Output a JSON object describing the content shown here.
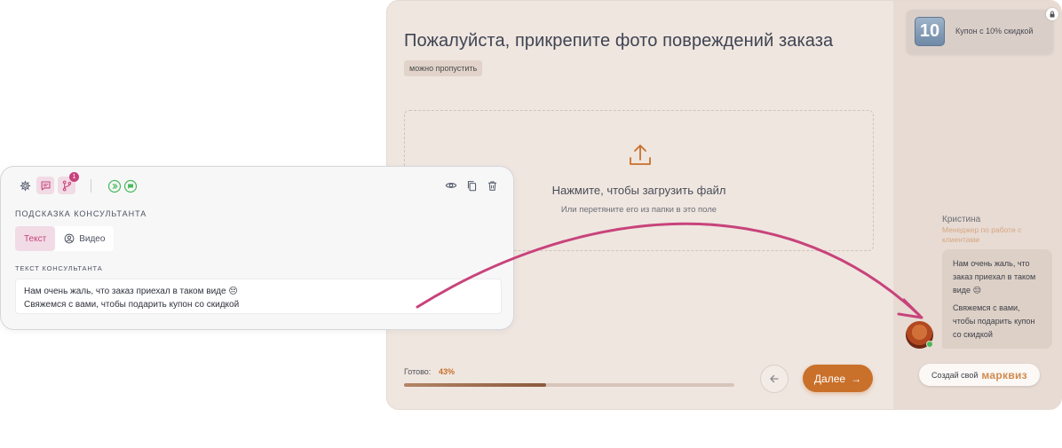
{
  "quiz": {
    "title": "Пожалуйста, прикрепите фото повреждений заказа",
    "skip_label": "можно пропустить",
    "upload": {
      "title": "Нажмите, чтобы загрузить файл",
      "subtitle": "Или перетяните его из папки в это поле",
      "icon": "upload-icon"
    },
    "progress": {
      "label": "Готово:",
      "value_text": "43%",
      "value": 43
    },
    "back_icon": "arrow-left-icon",
    "next_label": "Далее",
    "next_arrow": "→",
    "colors": {
      "accent": "#c9702a",
      "background": "#efe6e0",
      "sidebar": "#e7dbd3"
    }
  },
  "sidebar": {
    "coupon": {
      "number": "10",
      "text": "Купон с 10% скидкой"
    },
    "manager": {
      "name": "Кристина",
      "role": "Менеджер по работе с клиентами"
    },
    "messages": [
      "Нам очень жаль, что заказ приехал в таком виде 😔",
      "Свяжемся с вами, чтобы подарить купон со скидкой"
    ],
    "branding": {
      "prefix": "Создай свой",
      "brand": "марквиз"
    }
  },
  "consultant": {
    "toolbar": {
      "badge_count": "1",
      "icons": [
        "gear-icon",
        "chat-icon",
        "branch-icon",
        "play-circle-icon",
        "message-circle-icon",
        "eye-icon",
        "copy-icon",
        "trash-icon"
      ]
    },
    "title": "ПОДСКАЗКА КОНСУЛЬТАНТА",
    "tabs": [
      {
        "label": "Текст",
        "active": true
      },
      {
        "label": "Видео",
        "active": false
      }
    ],
    "field_label": "ТЕКСТ КОНСУЛЬТАНТА",
    "text_lines": [
      "Нам очень жаль, что заказ приехал в таком виде 😔",
      "Свяжемся с вами, чтобы подарить купон со скидкой"
    ],
    "colors": {
      "accent": "#c8437b",
      "arrow": "#c8437b"
    }
  }
}
